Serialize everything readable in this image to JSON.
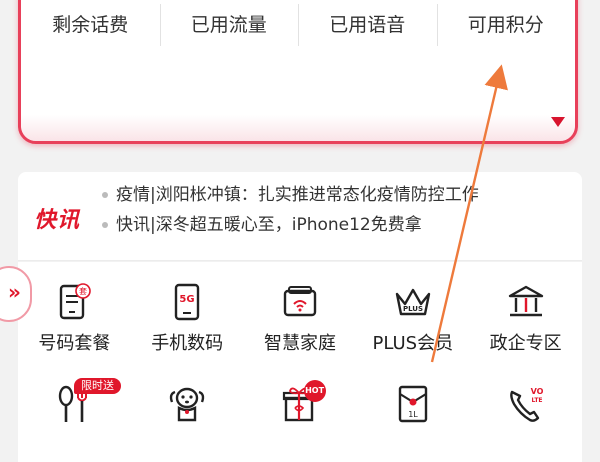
{
  "stats": {
    "tabs": [
      {
        "label": "剩余话费"
      },
      {
        "label": "已用流量"
      },
      {
        "label": "已用语音"
      },
      {
        "label": "可用积分"
      }
    ]
  },
  "news": {
    "logo": "快讯",
    "items": [
      {
        "text": "疫情|浏阳枨冲镇：扎实推进常态化疫情防控工作"
      },
      {
        "text": "快讯|深冬超五暖心至，iPhone12免费拿"
      }
    ]
  },
  "services": {
    "row1": [
      {
        "label": "号码套餐",
        "icon": "sim-card-icon"
      },
      {
        "label": "手机数码",
        "icon": "5g-phone-icon"
      },
      {
        "label": "智慧家庭",
        "icon": "smart-home-icon"
      },
      {
        "label": "PLUS会员",
        "icon": "plus-crown-icon"
      },
      {
        "label": "政企专区",
        "icon": "government-building-icon"
      }
    ],
    "row2": [
      {
        "icon": "fork-spoon-icon",
        "badge": "限时送"
      },
      {
        "icon": "dog-mascot-icon"
      },
      {
        "icon": "gift-box-icon",
        "badge": "HOT"
      },
      {
        "icon": "red-envelope-icon"
      },
      {
        "icon": "volte-phone-icon"
      }
    ]
  },
  "icon_glyphs": {
    "sim_badge": "套",
    "five_g": "5G",
    "plus": "PLUS",
    "envelope": "1L",
    "volte_top": "VO",
    "volte_bottom": "LTE"
  },
  "side_tab": {
    "icon": "double-chevron-right-icon",
    "glyph": "»"
  },
  "colors": {
    "accent": "#e0172b",
    "card_border": "#e8405a",
    "annotation_arrow": "#ee7a3c"
  }
}
